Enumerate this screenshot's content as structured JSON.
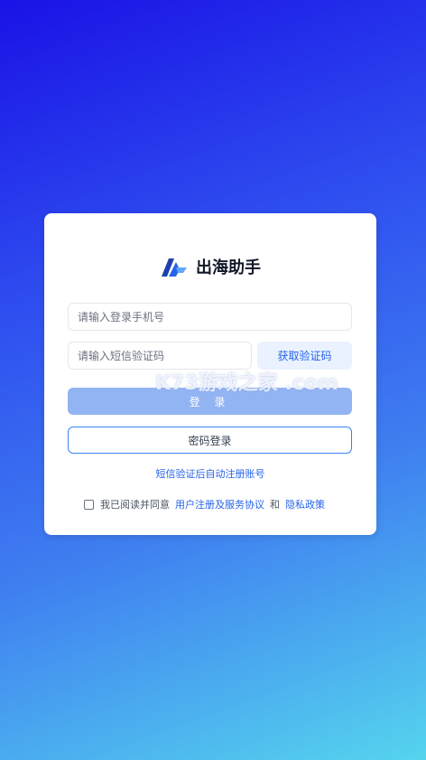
{
  "app": {
    "title": "出海助手"
  },
  "form": {
    "phone_placeholder": "请输入登录手机号",
    "code_placeholder": "请输入短信验证码",
    "get_code_label": "获取验证码",
    "login_label": "登 录",
    "password_login_label": "密码登录",
    "auto_register_hint": "短信验证后自动注册账号"
  },
  "agreement": {
    "prefix": "我已阅读并同意",
    "user_terms": "用户注册及服务协议",
    "and": "和",
    "privacy": "隐私政策",
    "checked": false
  },
  "watermark": {
    "text": "K73游戏之家 .com"
  },
  "colors": {
    "accent": "#2563eb",
    "login_disabled": "#93b4f3",
    "bg_top": "#1a12e6",
    "bg_bottom": "#55d4ee"
  }
}
